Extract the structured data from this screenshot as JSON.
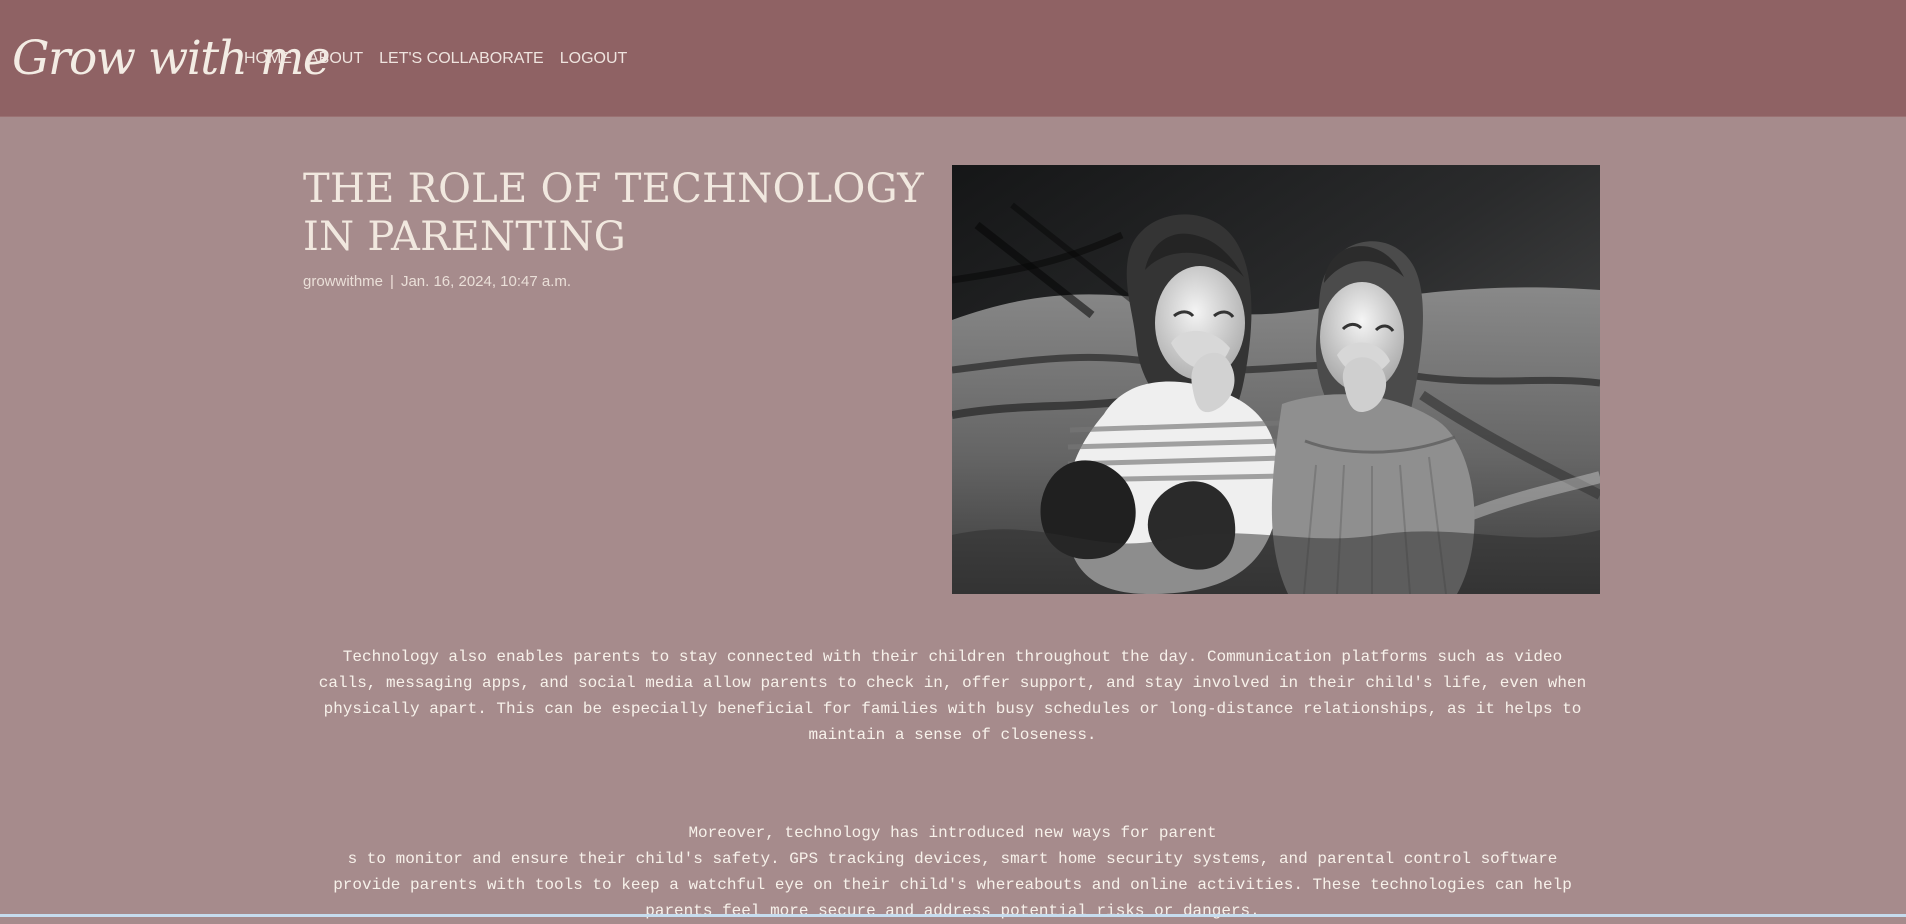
{
  "navbar": {
    "brand": "Grow with me",
    "links": [
      "HOME",
      "ABOUT",
      "LET'S COLLABORATE",
      "LOGOUT"
    ]
  },
  "post": {
    "title": "THE ROLE OF TECHNOLOGY IN PARENTING",
    "author": "growwithme",
    "separator": "|",
    "date": "Jan. 16, 2024, 10:47 a.m.",
    "paragraphs": [
      "Technology also enables parents to stay connected with their children throughout the day. Communication platforms such as video calls, messaging apps, and social media allow parents to check in, offer support, and stay involved in their child's life, even when physically apart. This can be especially beneficial for families with busy schedules or long-distance relationships, as it helps to maintain a sense of closeness.",
      "Moreover, technology has introduced new ways for parent\ns to monitor and ensure their child's safety. GPS tracking devices, smart home security systems, and parental control software provide parents with tools to keep a watchful eye on their child's whereabouts and online activities. These technologies can help parents feel more secure and address potential risks or dangers."
    ]
  },
  "colors": {
    "navbar": "#8f6264",
    "page_background": "#a68b8c",
    "title_text": "#f1e8df",
    "body_text": "#f7f1ea"
  }
}
